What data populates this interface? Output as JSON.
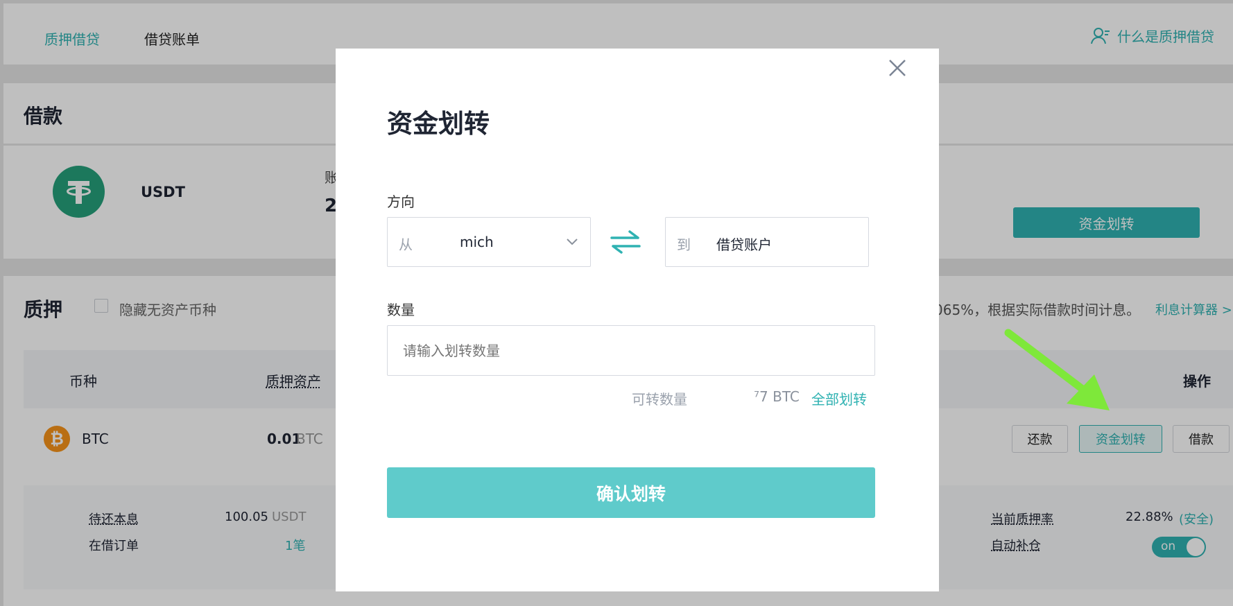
{
  "topnav": {
    "tab_pledge_loan": "质押借贷",
    "tab_loan_bill": "借贷账单",
    "help_link": "什么是质押借贷"
  },
  "borrow": {
    "title": "借款",
    "coin": "USDT",
    "partial_label": "账",
    "partial_value": "2",
    "transfer_button": "资金划转"
  },
  "pledge": {
    "title": "质押",
    "hide_zero_label": "隐藏无资产币种",
    "interest_note": "065%，根据实际借款时间计息。",
    "calc_link": "利息计算器 >",
    "columns": {
      "coin": "币种",
      "pledged_assets": "质押资产",
      "actions": "操作"
    },
    "row": {
      "coin": "BTC",
      "amount": "0.01",
      "unit": "BTC",
      "btn_repay": "还款",
      "btn_transfer": "资金划转",
      "btn_borrow": "借款"
    },
    "details": {
      "pending_label": "待还本息",
      "pending_value": "100.05",
      "pending_unit": "USDT",
      "orders_label": "在借订单",
      "orders_value": "1笔",
      "rate_label": "当前质押率",
      "rate_value": "22.88%",
      "rate_status": "(安全)",
      "auto_label": "自动补仓",
      "toggle_text": "on"
    }
  },
  "modal": {
    "title": "资金划转",
    "direction_label": "方向",
    "from_prefix": "从",
    "from_value": "mich",
    "to_prefix": "到",
    "to_value": "借贷账户",
    "amount_label": "数量",
    "amount_placeholder": "请输入划转数量",
    "available_label": "可转数量",
    "available_value": "⁷7 BTC",
    "all_transfer": "全部划转",
    "confirm_button": "确认划转"
  },
  "colors": {
    "accent": "#2fb2b2",
    "confirm_button": "#5fcbcb",
    "arrow": "#7ee83a",
    "btc": "#f7931a",
    "usdt": "#26a17b"
  }
}
